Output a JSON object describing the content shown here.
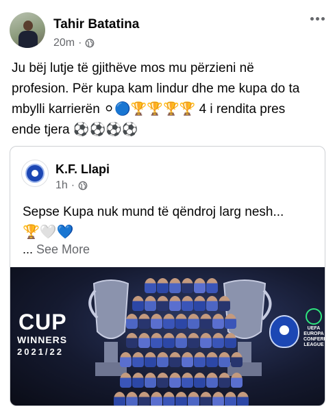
{
  "post": {
    "author": "Tahir Batatina",
    "time": "20m",
    "separator": "·",
    "text_lines": [
      "Ju bëj lutje të gjithëve mos mu përzieni në",
      "profesion. Për kupa kam lindur dhe me kupa do ta",
      "mbylli karrierën ⚪🔵🏆🏆🏆🏆 4 i rendita pres",
      "ende tjera ⚽⚽⚽⚽"
    ]
  },
  "shared": {
    "author": "K.F. Llapi",
    "time": "1h",
    "separator": "·",
    "text": "Sepse Kupa nuk mund të qëndroj larg nesh...",
    "emojis": "🏆🤍💙",
    "ellipsis": "...",
    "see_more": "See More",
    "banner": {
      "cup": "CUP",
      "winners": "WINNERS",
      "season": "2021/22",
      "uecl_lines": [
        "UEFA",
        "EUROPA",
        "CONFERENCE",
        "LEAGUE"
      ]
    }
  },
  "icons": {
    "avatar": "profile-photo",
    "visibility": "globe-icon",
    "menu": "more-options-icon",
    "club_logo": "kf-llapi-crest",
    "competition": "uefa-conference-league-logo"
  },
  "colors": {
    "secondary_text": "#65676b",
    "border": "#ced0d4",
    "banner_bg": "#151a30",
    "club_blue": "#1c47b4"
  }
}
